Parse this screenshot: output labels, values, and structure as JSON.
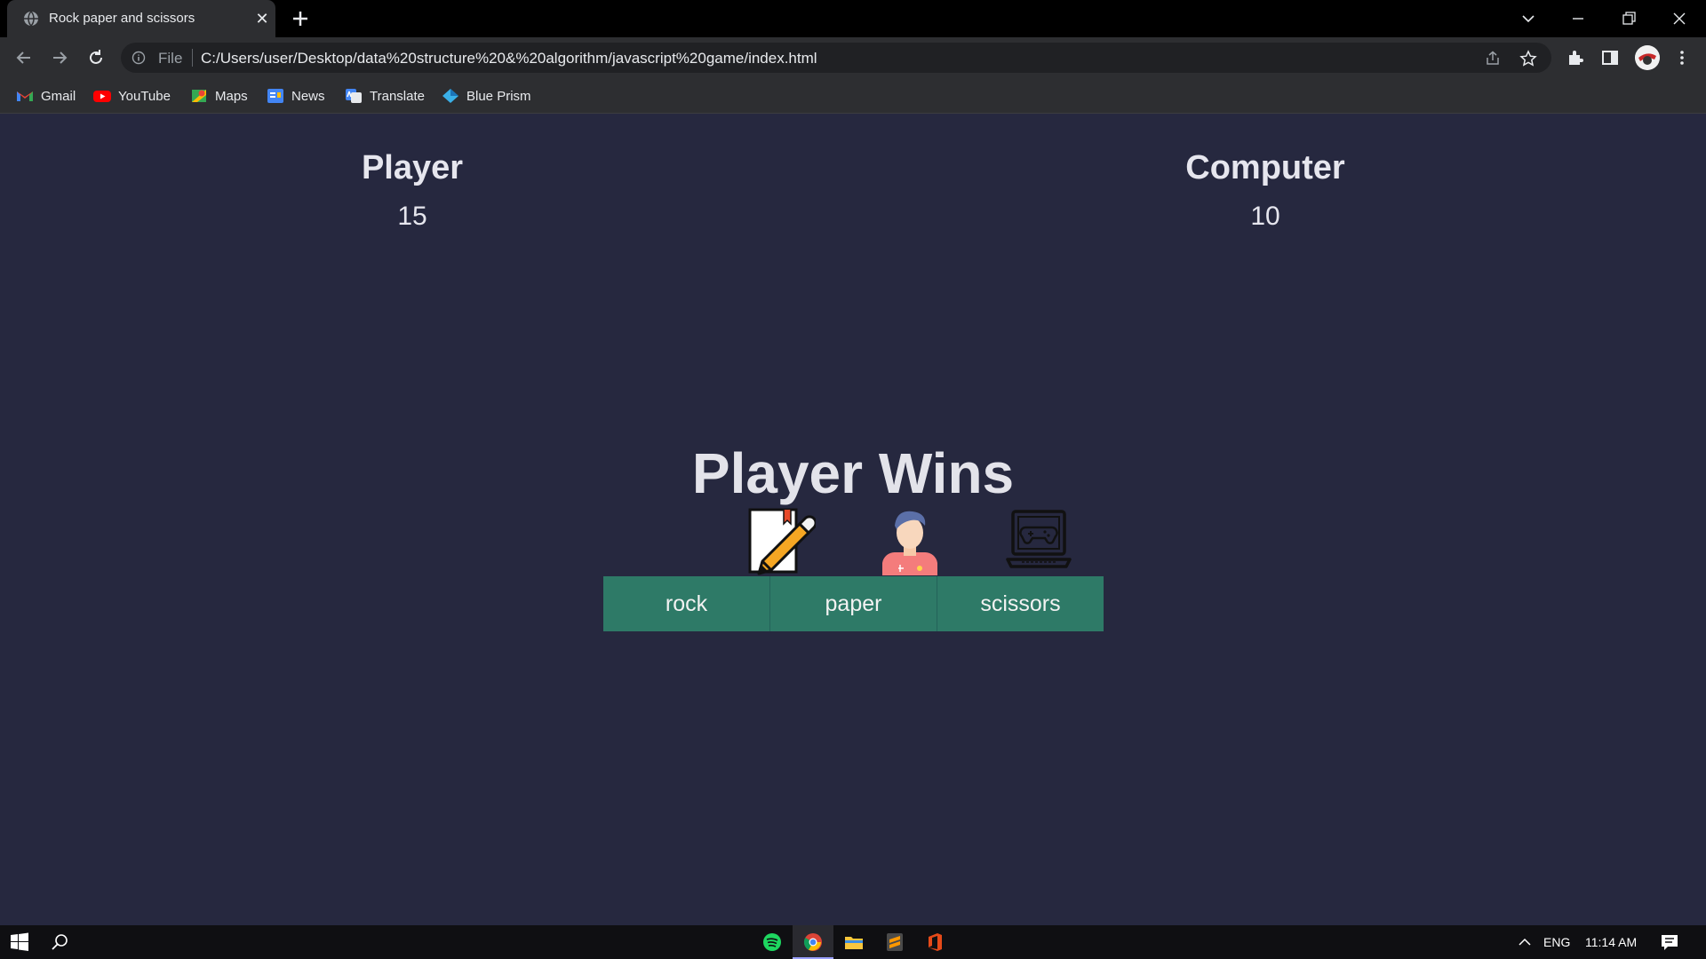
{
  "browser": {
    "tab_title": "Rock paper and scissors",
    "new_tab_symbol": "+",
    "close_symbol": "✕",
    "scheme_label": "File",
    "url": "C:/Users/user/Desktop/data%20structure%20&%20algorithm/javascript%20game/index.html",
    "bookmarks": [
      {
        "label": "Gmail",
        "icon": "gmail-icon",
        "color": "#ea4335"
      },
      {
        "label": "YouTube",
        "icon": "youtube-icon",
        "color": "#ff0000"
      },
      {
        "label": "Maps",
        "icon": "maps-icon",
        "color": "#34a853"
      },
      {
        "label": "News",
        "icon": "news-icon",
        "color": "#4285f4"
      },
      {
        "label": "Translate",
        "icon": "translate-icon",
        "color": "#4285f4"
      },
      {
        "label": "Blue Prism",
        "icon": "blue-prism-icon",
        "color": "#3ab0e8"
      }
    ]
  },
  "game": {
    "player_label": "Player",
    "player_score": "15",
    "computer_label": "Computer",
    "computer_score": "10",
    "result": "Player Wins",
    "choices": [
      "rock",
      "paper",
      "scissors"
    ],
    "choice_icons": [
      "notepad-pencil-icon",
      "person-icon",
      "laptop-gamepad-icon"
    ],
    "button_color": "#2e7a67",
    "background_color": "#26283f"
  },
  "taskbar": {
    "apps": [
      "spotify-icon",
      "chrome-icon",
      "file-explorer-icon",
      "sublime-text-icon",
      "office-icon"
    ],
    "language": "ENG",
    "time": "11:14 AM"
  }
}
